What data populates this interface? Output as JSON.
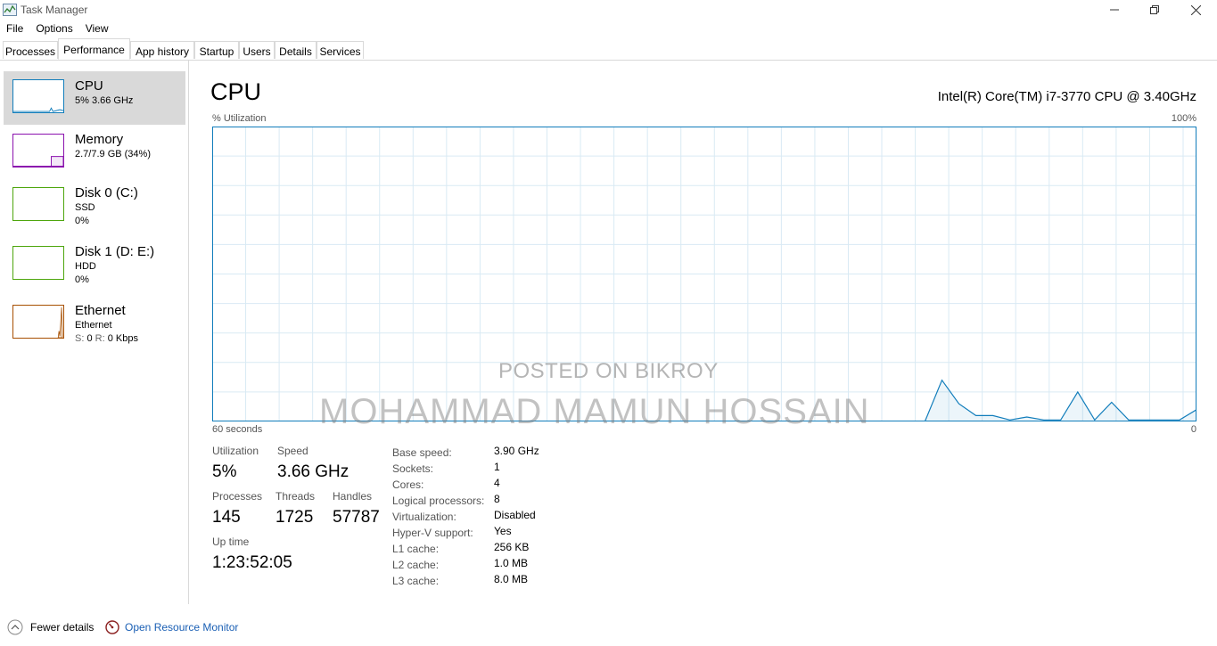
{
  "window": {
    "title": "Task Manager",
    "minimize_icon": "minimize-icon",
    "restore_icon": "restore-icon",
    "close_icon": "close-icon"
  },
  "menu": [
    "File",
    "Options",
    "View"
  ],
  "tabs": [
    "Processes",
    "Performance",
    "App history",
    "Startup",
    "Users",
    "Details",
    "Services"
  ],
  "active_tab": "Performance",
  "sidebar": [
    {
      "title": "CPU",
      "line1": "5% 3.66 GHz",
      "color": "#117dbb"
    },
    {
      "title": "Memory",
      "line1": "2.7/7.9 GB (34%)",
      "color": "#8b12ae"
    },
    {
      "title": "Disk 0 (C:)",
      "line1": "SSD",
      "line2": "0%",
      "color": "#4da60c"
    },
    {
      "title": "Disk 1 (D: E:)",
      "line1": "HDD",
      "line2": "0%",
      "color": "#4da60c"
    },
    {
      "title": "Ethernet",
      "line1": "Ethernet",
      "line2_s": "S:",
      "line2_s_val": "0",
      "line2_r": "R:",
      "line2_r_val": "0 Kbps",
      "color": "#a74f01"
    }
  ],
  "main": {
    "title": "CPU",
    "model": "Intel(R) Core(TM) i7-3770 CPU @ 3.40GHz",
    "y_label": "% Utilization",
    "y_max": "100%",
    "x_label": "60 seconds",
    "y_min": "0",
    "stats": {
      "utilization_label": "Utilization",
      "utilization": "5%",
      "speed_label": "Speed",
      "speed": "3.66 GHz",
      "processes_label": "Processes",
      "processes": "145",
      "threads_label": "Threads",
      "threads": "1725",
      "handles_label": "Handles",
      "handles": "57787",
      "uptime_label": "Up time",
      "uptime": "1:23:52:05"
    },
    "specs": [
      {
        "label": "Base speed:",
        "value": "3.90 GHz"
      },
      {
        "label": "Sockets:",
        "value": "1"
      },
      {
        "label": "Cores:",
        "value": "4"
      },
      {
        "label": "Logical processors:",
        "value": "8"
      },
      {
        "label": "Virtualization:",
        "value": "Disabled"
      },
      {
        "label": "Hyper-V support:",
        "value": "Yes"
      },
      {
        "label": "L1 cache:",
        "value": "256 KB"
      },
      {
        "label": "L2 cache:",
        "value": "1.0 MB"
      },
      {
        "label": "L3 cache:",
        "value": "8.0 MB"
      }
    ],
    "utilization_history": [
      0,
      0,
      0,
      0,
      0,
      0,
      0,
      0,
      0,
      0,
      0,
      0,
      0,
      0,
      0,
      0,
      0,
      0,
      0,
      0,
      0,
      0,
      0,
      0,
      0,
      0,
      0,
      0,
      0,
      0,
      0,
      0,
      0,
      0,
      0,
      0,
      0,
      0,
      0,
      0,
      0,
      0,
      0,
      14,
      6,
      2,
      2,
      0.5,
      1.5,
      0.5,
      0.5,
      10,
      0.5,
      6.5,
      0.5,
      0.5,
      0.5,
      0.5,
      4
    ],
    "graph_color": "#117dbb"
  },
  "watermark": {
    "line1": "POSTED ON BIKROY",
    "line2": "MOHAMMAD MAMUN HOSSAIN"
  },
  "footer": {
    "fewer_details": "Fewer details",
    "resource_monitor": "Open Resource Monitor",
    "fewer_icon": "chevron-up-icon",
    "monitor_icon": "resource-monitor-icon"
  }
}
